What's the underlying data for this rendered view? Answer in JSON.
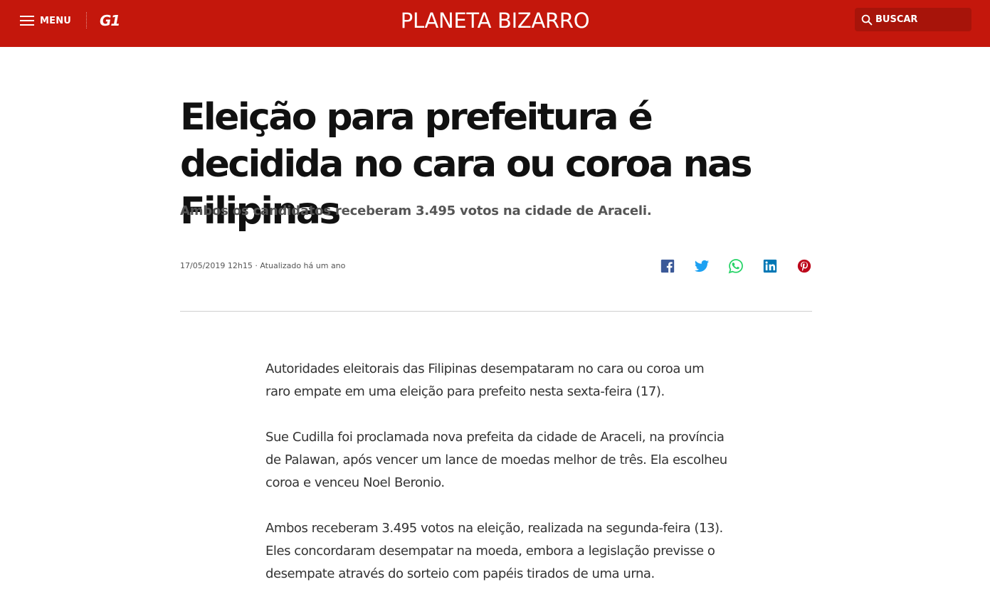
{
  "header": {
    "menu_label": "MENU",
    "logo_text": "G1",
    "section_title": "PLANETA BIZARRO",
    "search_label": "BUSCAR",
    "background_color": "#c4170c"
  },
  "article": {
    "title": "Eleição para prefeitura é decidida no cara ou coroa nas Filipinas",
    "subtitle": "Ambos os candidatos receberam 3.495 votos na cidade de Araceli.",
    "meta": "17/05/2019 12h15 · Atualizado há um ano",
    "paragraphs": [
      "Autoridades eleitorais das Filipinas desempataram no cara ou coroa um raro empate em uma eleição para prefeito nesta sexta-feira (17).",
      "Sue Cudilla foi proclamada nova prefeita da cidade de Araceli, na província de Palawan, após vencer um lance de moedas melhor de três. Ela escolheu coroa e venceu Noel Beronio.",
      "Ambos receberam 3.495 votos na eleição, realizada na segunda-feira (13). Eles concordaram desempatar na moeda, embora a legislação previsse o desempate através do sorteio com papéis tirados de uma urna."
    ]
  },
  "share": {
    "icons": [
      "facebook-icon",
      "twitter-icon",
      "whatsapp-icon",
      "linkedin-icon",
      "pinterest-icon"
    ],
    "colors": {
      "facebook": "#3b5998",
      "twitter": "#1da1f2",
      "whatsapp": "#25d366",
      "linkedin": "#0077b5",
      "pinterest": "#bd081c"
    }
  }
}
